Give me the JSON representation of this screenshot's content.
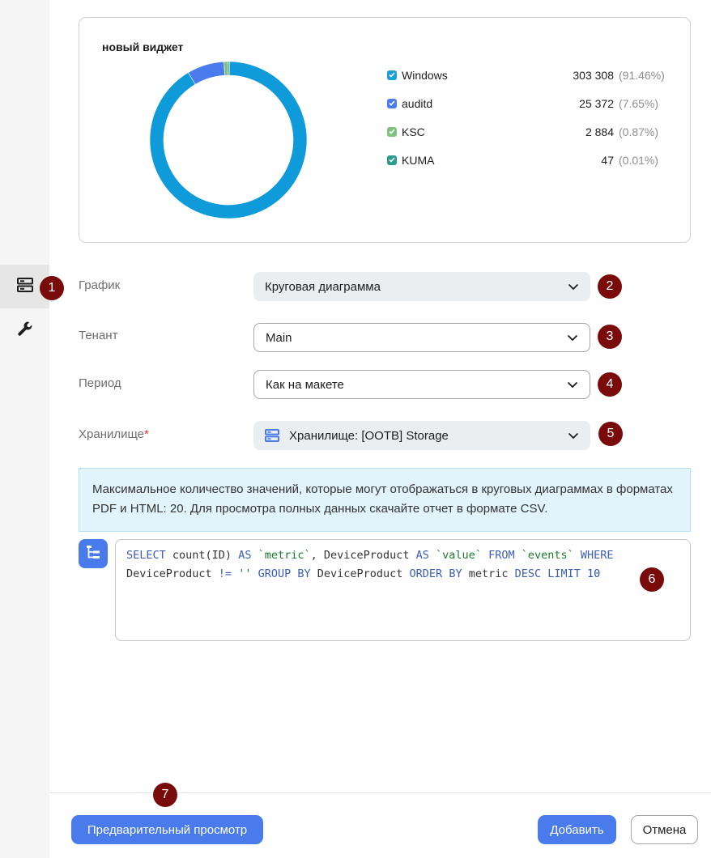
{
  "widget": {
    "title": "новый виджет",
    "legend": [
      {
        "name": "Windows",
        "value": "303 308",
        "percent": "(91.46%)",
        "color": "#1a9fd8"
      },
      {
        "name": "auditd",
        "value": "25 372",
        "percent": "(7.65%)",
        "color": "#4a7bec"
      },
      {
        "name": "KSC",
        "value": "2 884",
        "percent": "(0.87%)",
        "color": "#7ec27e"
      },
      {
        "name": "KUMA",
        "value": "47",
        "percent": "(0.01%)",
        "color": "#2a9d8f"
      }
    ]
  },
  "chart_data": {
    "type": "pie",
    "title": "новый виджет",
    "categories": [
      "Windows",
      "auditd",
      "KSC",
      "KUMA"
    ],
    "values": [
      303308,
      25372,
      2884,
      47
    ],
    "percent": [
      91.46,
      7.65,
      0.87,
      0.01
    ],
    "colors": [
      "#0f9ad9",
      "#4a7bec",
      "#7ec27e",
      "#2a9d8f"
    ],
    "legend": "right"
  },
  "form": {
    "chart_label": "График",
    "chart_value": "Круговая диаграмма",
    "tenant_label": "Тенант",
    "tenant_value": "Main",
    "period_label": "Период",
    "period_value": "Как на макете",
    "storage_label": "Хранилище",
    "storage_required": "*",
    "storage_value": "Хранилище: [OOTB] Storage"
  },
  "info_text": "Максимальное количество значений, которые могут отображаться в круговых диаграммах в форматах PDF и HTML: 20. Для просмотра полных данных скачайте отчет в формате CSV.",
  "sql": {
    "t1": "SELECT",
    "t2": " count(ID) ",
    "t3": "AS",
    "t4": " `metric`",
    "t5": ", DeviceProduct ",
    "t6": "AS",
    "t7": " `value`",
    "t8": " ",
    "t9": "FROM",
    "t10": " `events`",
    "t11": " ",
    "t12": "WHERE",
    "t13": "DeviceProduct ",
    "t14": "!=",
    "t15": " ''",
    "t16": " ",
    "t17": "GROUP BY",
    "t18": " DeviceProduct ",
    "t19": "ORDER BY",
    "t20": " metric ",
    "t21": "DESC",
    "t22": " ",
    "t23": "LIMIT",
    "t24": " 10"
  },
  "markers": [
    "1",
    "2",
    "3",
    "4",
    "5",
    "6",
    "7"
  ],
  "footer": {
    "preview_label": "Предварительный просмотр",
    "add_label": "Добавить",
    "cancel_label": "Отмена"
  },
  "icons": {
    "sidebar_1": "storage-icon",
    "sidebar_2": "wrench-icon",
    "sql": "tree-icon"
  }
}
